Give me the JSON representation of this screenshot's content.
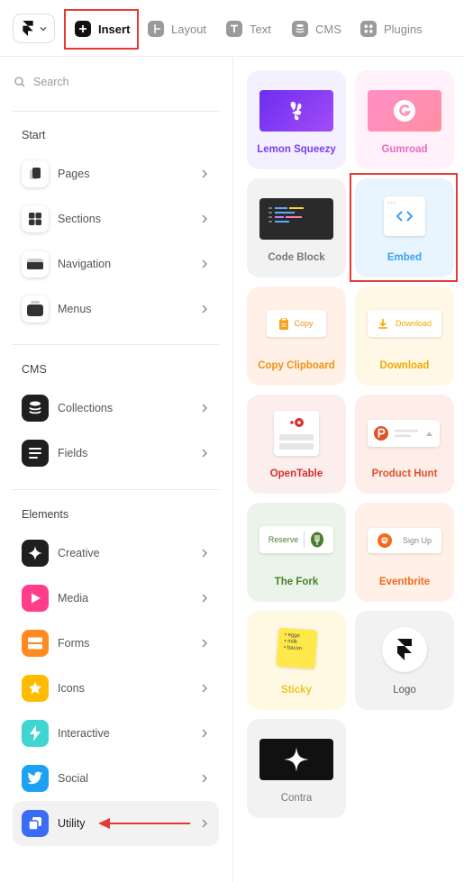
{
  "toolbar": {
    "app_menu_icon": "framer-logo-icon",
    "tabs": [
      {
        "label": "Insert",
        "icon": "plus-square-icon",
        "active": true
      },
      {
        "label": "Layout",
        "icon": "layout-icon",
        "active": false
      },
      {
        "label": "Text",
        "icon": "text-icon",
        "active": false
      },
      {
        "label": "CMS",
        "icon": "database-icon",
        "active": false
      },
      {
        "label": "Plugins",
        "icon": "plugins-icon",
        "active": false
      }
    ]
  },
  "sidebar": {
    "search_placeholder": "Search",
    "sections": [
      {
        "title": "Start",
        "items": [
          {
            "label": "Pages",
            "icon": "pages-icon"
          },
          {
            "label": "Sections",
            "icon": "sections-icon"
          },
          {
            "label": "Navigation",
            "icon": "navigation-icon"
          },
          {
            "label": "Menus",
            "icon": "menus-icon"
          }
        ]
      },
      {
        "title": "CMS",
        "items": [
          {
            "label": "Collections",
            "icon": "collections-icon"
          },
          {
            "label": "Fields",
            "icon": "fields-icon"
          }
        ]
      },
      {
        "title": "Elements",
        "items": [
          {
            "label": "Creative",
            "icon": "sparkle-icon",
            "color": "#1f1f1f"
          },
          {
            "label": "Media",
            "icon": "play-icon",
            "color": "#ff3d8b"
          },
          {
            "label": "Forms",
            "icon": "forms-icon",
            "color": "#ff8a1f"
          },
          {
            "label": "Icons",
            "icon": "star-icon",
            "color": "#ffbb00"
          },
          {
            "label": "Interactive",
            "icon": "bolt-icon",
            "color": "#3fd6d2"
          },
          {
            "label": "Social",
            "icon": "twitter-bird-icon",
            "color": "#1da1f2"
          },
          {
            "label": "Utility",
            "icon": "utility-icon",
            "color": "#3b6cf6",
            "selected": true
          }
        ]
      }
    ]
  },
  "grid": {
    "items": [
      {
        "label": "Lemon Squeezy",
        "bg": "#f5f0ff",
        "color": "#7b3df2"
      },
      {
        "label": "Gumroad",
        "bg": "#fff0fa",
        "color": "#e86ac2"
      },
      {
        "label": "Code Block",
        "bg": "#f2f2f2",
        "color": "#777777"
      },
      {
        "label": "Embed",
        "bg": "#e8f4fe",
        "color": "#3ba1ef",
        "icon": "code-brackets-icon"
      },
      {
        "label": "Copy Clipboard",
        "bg": "#fff1e8",
        "color": "#f2910f",
        "button": "Copy"
      },
      {
        "label": "Download",
        "bg": "#fff8e6",
        "color": "#f5a800",
        "button": "Download"
      },
      {
        "label": "OpenTable",
        "bg": "#fdeeee",
        "color": "#d72e2e"
      },
      {
        "label": "Product Hunt",
        "bg": "#fdeee9",
        "color": "#e0512c"
      },
      {
        "label": "The Fork",
        "bg": "#eaf4e8",
        "color": "#4b7e2e",
        "button": "Reserve"
      },
      {
        "label": "Eventbrite",
        "bg": "#fff0e8",
        "color": "#f26b1d",
        "button": "Sign Up"
      },
      {
        "label": "Sticky",
        "bg": "#fff9e3",
        "color": "#f1c21c",
        "note": [
          "• eggs",
          "• milk",
          "• bacon"
        ]
      },
      {
        "label": "Logo",
        "bg": "#f2f2f2",
        "color": "#555555"
      },
      {
        "label": "Contra",
        "bg": "#f2f2f2",
        "color": "#777777"
      }
    ]
  }
}
